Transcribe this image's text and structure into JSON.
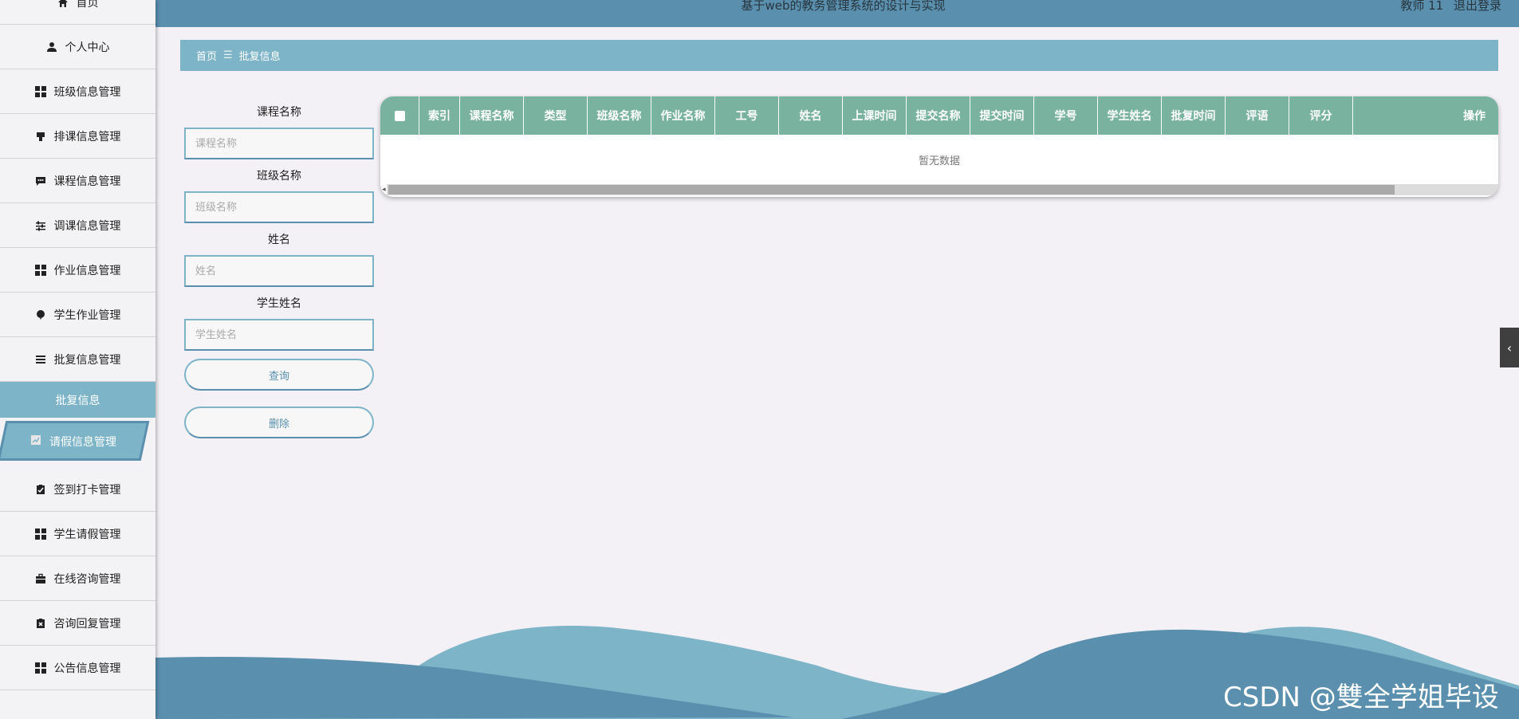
{
  "header": {
    "title": "基于web的教务管理系统的设计与实现",
    "user": "教师 11",
    "logout": "退出登录"
  },
  "sidebar": {
    "items": [
      {
        "label": "首页",
        "icon": "home-icon"
      },
      {
        "label": "个人中心",
        "icon": "user-icon"
      },
      {
        "label": "班级信息管理",
        "icon": "grid-icon"
      },
      {
        "label": "排课信息管理",
        "icon": "cup-icon"
      },
      {
        "label": "课程信息管理",
        "icon": "chat-icon"
      },
      {
        "label": "调课信息管理",
        "icon": "sliders-icon"
      },
      {
        "label": "作业信息管理",
        "icon": "grid-icon"
      },
      {
        "label": "学生作业管理",
        "icon": "balloon-icon"
      },
      {
        "label": "批复信息管理",
        "icon": "list-icon"
      },
      {
        "label": "请假信息管理",
        "icon": "chart-icon"
      },
      {
        "label": "签到打卡管理",
        "icon": "clipboard-check-icon"
      },
      {
        "label": "学生请假管理",
        "icon": "grid-icon"
      },
      {
        "label": "在线咨询管理",
        "icon": "briefcase-icon"
      },
      {
        "label": "咨询回复管理",
        "icon": "clipboard-x-icon"
      },
      {
        "label": "公告信息管理",
        "icon": "grid-icon"
      }
    ],
    "submenu_label": "批复信息"
  },
  "breadcrumb": {
    "home": "首页",
    "separator": "☰",
    "current": "批复信息"
  },
  "search": {
    "course": {
      "label": "课程名称",
      "placeholder": "课程名称"
    },
    "class": {
      "label": "班级名称",
      "placeholder": "班级名称"
    },
    "name": {
      "label": "姓名",
      "placeholder": "姓名"
    },
    "student": {
      "label": "学生姓名",
      "placeholder": "学生姓名"
    },
    "query_button": "查询",
    "delete_button": "删除"
  },
  "table": {
    "columns": [
      "索引",
      "课程名称",
      "类型",
      "班级名称",
      "作业名称",
      "工号",
      "姓名",
      "上课时间",
      "提交名称",
      "提交时间",
      "学号",
      "学生姓名",
      "批复时间",
      "评语",
      "评分",
      "操作"
    ],
    "empty_text": "暂无数据"
  },
  "watermark": "CSDN @雙全学姐毕设",
  "colors": {
    "header": "#5a90ae",
    "accent": "#7db4c7",
    "table_header": "#79b3a0",
    "background": "#f3f1f5"
  }
}
